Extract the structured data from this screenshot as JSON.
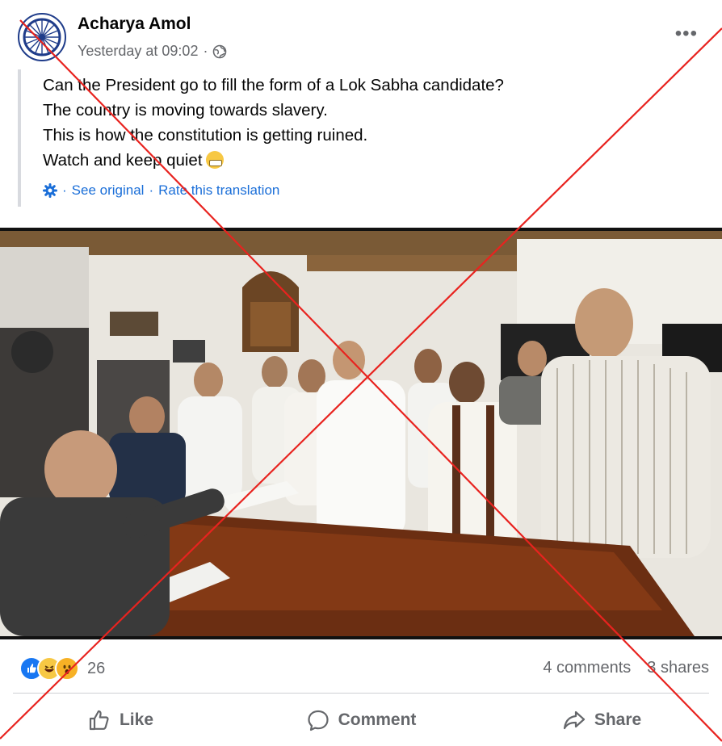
{
  "post": {
    "author": "Acharya Amol",
    "timestamp": "Yesterday at 09:02",
    "separator": "·",
    "privacy_icon": "globe-icon",
    "more_label": "•••",
    "lines": [
      "Can the President go to fill the form of a Lok Sabha candidate?",
      "The country is moving towards slavery.",
      "This is how the constitution is getting ruined.",
      "Watch and keep quiet"
    ],
    "translation": {
      "see_original": "See original",
      "separator": "·",
      "rate": "Rate this translation"
    }
  },
  "engagement": {
    "reaction_icons": [
      "like-icon",
      "haha-icon",
      "wow-icon"
    ],
    "reaction_count": "26",
    "comments": "4 comments",
    "shares": "3 shares"
  },
  "actions": {
    "like": "Like",
    "comment": "Comment",
    "share": "Share"
  },
  "colors": {
    "link": "#1a6ed8",
    "muted": "#65676b",
    "cross": "#e8231f",
    "like_blue": "#1877f2"
  }
}
